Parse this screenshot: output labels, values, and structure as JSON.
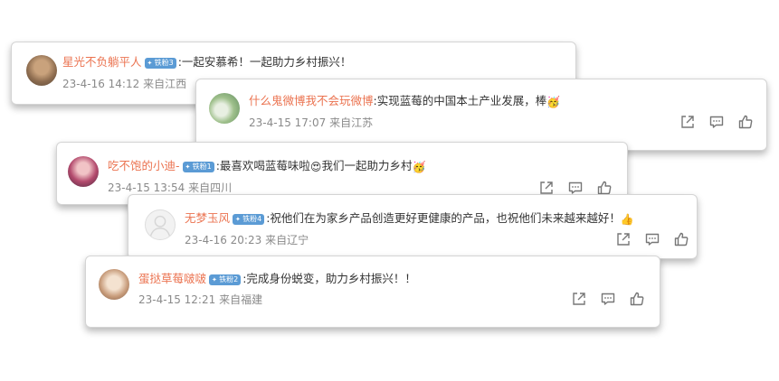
{
  "comments": [
    {
      "username": "星光不负躺平人",
      "badge": "铁粉3",
      "text": ":一起安慕希！一起助力乡村振兴！",
      "date": "23-4-16 14:12",
      "location": "来自江西"
    },
    {
      "username": "什么鬼微博我不会玩微博",
      "badge": "",
      "text": ":实现蓝莓的中国本土产业发展，棒",
      "emoji": "🥳",
      "date": "23-4-15 17:07",
      "location": "来自江苏"
    },
    {
      "username": "吃不饱的小迪-",
      "badge": "铁粉1",
      "text": ":最喜欢喝蓝莓味啦",
      "emoji": "😍",
      "text2": "我们一起助力乡村",
      "emoji2": "🥳",
      "date": "23-4-15 13:54",
      "location": "来自四川"
    },
    {
      "username": "无梦玉风",
      "badge": "铁粉4",
      "text": ":祝他们在为家乡产品创造更好更健康的产品，也祝他们未来越来越好！",
      "emoji": "👍",
      "date": "23-4-16 20:23",
      "location": "来自辽宁"
    },
    {
      "username": "蛋挞草莓啵啵",
      "badge": "铁粉2",
      "text": ":完成身份蜕变，助力乡村振兴！！",
      "date": "23-4-15 12:21",
      "location": "来自福建"
    }
  ],
  "icons": {
    "share": "share-icon",
    "comment": "comment-icon",
    "like": "like-icon"
  },
  "colors": {
    "username": "#eb7350",
    "badge": "#5b9bd5",
    "meta": "#8a8a8a"
  }
}
